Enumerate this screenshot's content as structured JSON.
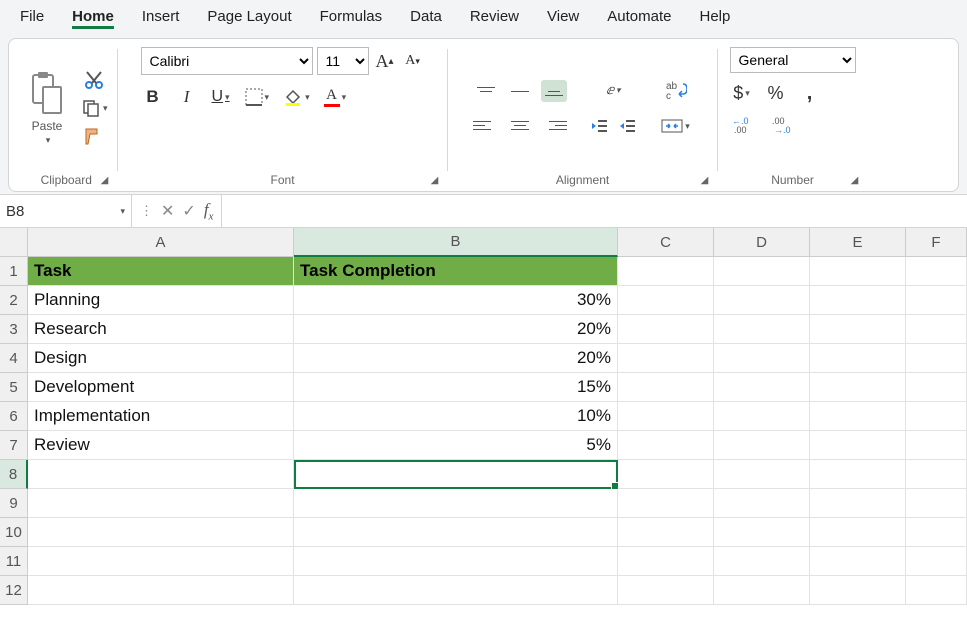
{
  "menu": {
    "items": [
      "File",
      "Home",
      "Insert",
      "Page Layout",
      "Formulas",
      "Data",
      "Review",
      "View",
      "Automate",
      "Help"
    ],
    "active": "Home"
  },
  "ribbon": {
    "clipboard": {
      "paste_label": "Paste",
      "group_label": "Clipboard"
    },
    "font": {
      "group_label": "Font",
      "font_name": "Calibri",
      "font_size": "11",
      "bold": "B",
      "italic": "I",
      "underline": "U"
    },
    "alignment": {
      "group_label": "Alignment"
    },
    "number": {
      "group_label": "Number",
      "format": "General",
      "dollar": "$",
      "percent": "%",
      "comma": ","
    }
  },
  "namebox": {
    "ref": "B8"
  },
  "formula_bar": {
    "value": ""
  },
  "sheet": {
    "columns": [
      "A",
      "B",
      "C",
      "D",
      "E",
      "F"
    ],
    "row_numbers": [
      "1",
      "2",
      "3",
      "4",
      "5",
      "6",
      "7",
      "8",
      "9",
      "10",
      "11",
      "12"
    ],
    "header_row": {
      "a": "Task",
      "b": "Task Completion"
    },
    "data_rows": [
      {
        "a": "Planning",
        "b": "30%"
      },
      {
        "a": "Research",
        "b": "20%"
      },
      {
        "a": "Design",
        "b": "20%"
      },
      {
        "a": "Development",
        "b": "15%"
      },
      {
        "a": "Implementation",
        "b": "10%"
      },
      {
        "a": "Review",
        "b": "5%"
      }
    ],
    "selected_cell": "B8"
  }
}
